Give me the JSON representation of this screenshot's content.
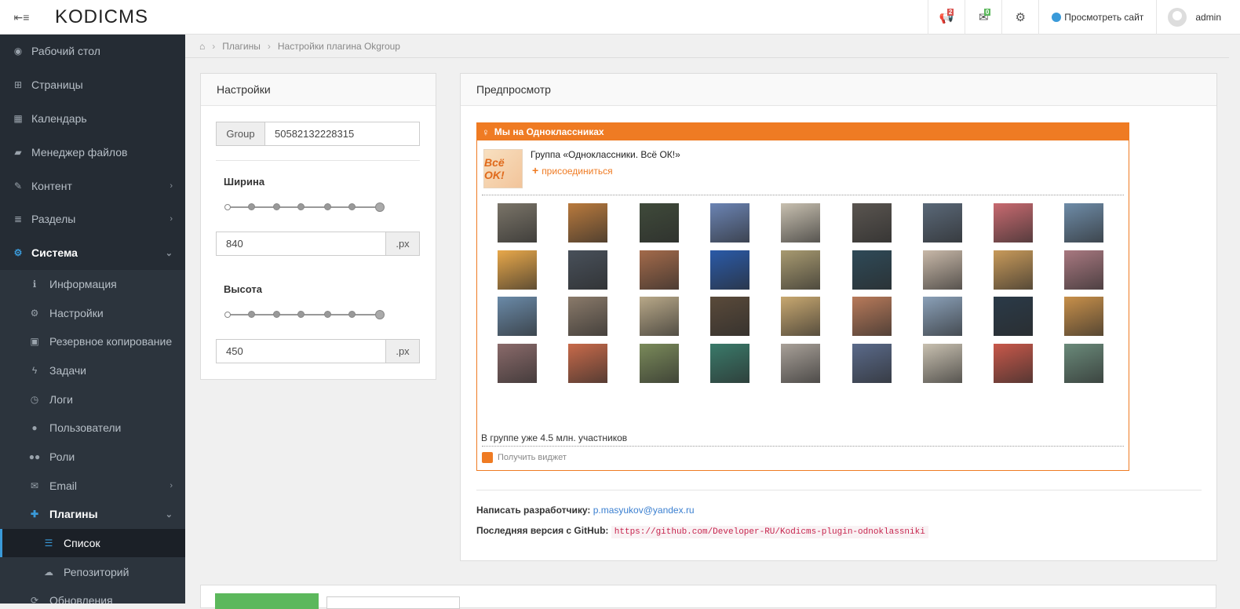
{
  "app": {
    "logo": "KODICMS"
  },
  "topbar": {
    "notifications_count": "2",
    "messages_count": "0",
    "view_site_label": "Просмотреть сайт",
    "user_name": "admin"
  },
  "sidebar": {
    "items": [
      {
        "label": "Рабочий стол",
        "icon": "dashboard-icon"
      },
      {
        "label": "Страницы",
        "icon": "sitemap-icon"
      },
      {
        "label": "Календарь",
        "icon": "calendar-icon"
      },
      {
        "label": "Менеджер файлов",
        "icon": "folder-icon"
      },
      {
        "label": "Контент",
        "icon": "edit-icon"
      },
      {
        "label": "Разделы",
        "icon": "list-icon"
      },
      {
        "label": "Система",
        "icon": "gear-icon"
      }
    ],
    "system_items": [
      {
        "label": "Информация",
        "icon": "info-icon"
      },
      {
        "label": "Настройки",
        "icon": "cog-icon"
      },
      {
        "label": "Резервное копирование",
        "icon": "archive-icon"
      },
      {
        "label": "Задачи",
        "icon": "bolt-icon"
      },
      {
        "label": "Логи",
        "icon": "clock-icon"
      },
      {
        "label": "Пользователи",
        "icon": "user-icon"
      },
      {
        "label": "Роли",
        "icon": "users-icon"
      },
      {
        "label": "Email",
        "icon": "envelope-icon"
      },
      {
        "label": "Плагины",
        "icon": "puzzle-icon"
      }
    ],
    "plugin_items": [
      {
        "label": "Список",
        "icon": "list-ul-icon"
      },
      {
        "label": "Репозиторий",
        "icon": "cloud-icon"
      }
    ],
    "partial_item": "Обновления"
  },
  "breadcrumb": [
    "Плагины",
    "Настройки плагина Okgroup"
  ],
  "settings": {
    "title": "Настройки",
    "group_label": "Group",
    "group_value": "50582132228315",
    "width_label": "Ширина",
    "width_value": "840",
    "height_label": "Высота",
    "height_value": "450",
    "unit": ".px"
  },
  "preview": {
    "title": "Предпросмотр",
    "widget_header": "Мы на Одноклассниках",
    "group_img_text": "Всё OK!",
    "group_name": "Группа «Одноклассники. Всё ОК!»",
    "join_label": "присоединиться",
    "members_text": "В группе уже 4.5 млн. участников",
    "get_widget": "Получить виджет",
    "member_colors": [
      [
        "#7a7468",
        "#b97a3d",
        "#3f4a3a",
        "#6b84b4",
        "#c8c0b0",
        "#5a5550",
        "#5a6878",
        "#c86a70",
        "#6e8ca8"
      ],
      [
        "#e8a84a",
        "#48505a",
        "#a36a4a",
        "#2a5aa8",
        "#a89a70",
        "#2e4a58",
        "#c8b8a8",
        "#c89a5a",
        "#a87880"
      ],
      [
        "#6a8aa8",
        "#8a7a6a",
        "#b8a888",
        "#5a4a3a",
        "#c8a870",
        "#b87a5a",
        "#8aa0b8",
        "#2a3a48",
        "#c8904a"
      ],
      [
        "#8a6a6a",
        "#c86a4a",
        "#7a8a5a",
        "#3a7a6a",
        "#a8a098",
        "#5a6a8a",
        "#c8c0b0",
        "#c8584a",
        "#6a8a7a"
      ]
    ]
  },
  "developer": {
    "write_label": "Написать разработчику:",
    "email": "p.masyukov@yandex.ru",
    "github_label": "Последняя версия с GitHub:",
    "github_url": "https://github.com/Developer-RU/Kodicms-plugin-odnoklassniki"
  }
}
